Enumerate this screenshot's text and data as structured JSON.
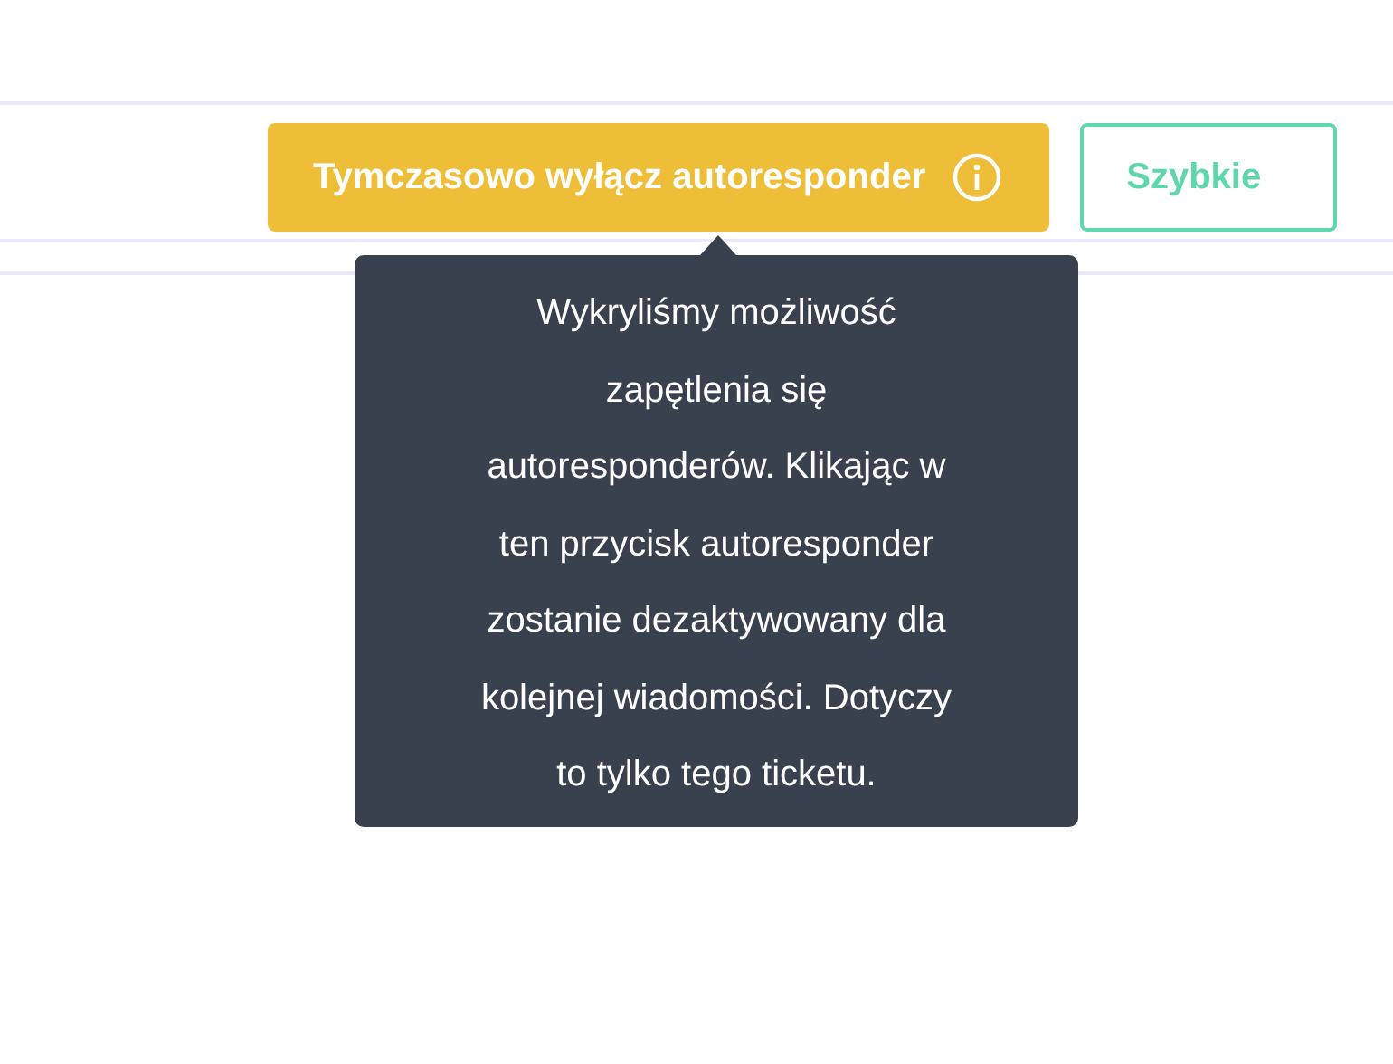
{
  "toolbar": {
    "buttons": [
      {
        "kind": "warning",
        "label": "Tymczasowo wyłącz autoresponder"
      },
      {
        "kind": "outline",
        "label": "Szybkie"
      }
    ]
  },
  "tooltip": {
    "lines": [
      "Wykryliśmy możliwość",
      "zapętlenia się",
      "autoresponderów. Klikając w",
      "ten przycisk autoresponder",
      "zostanie dezaktywowany dla",
      "kolejnej wiadomości. Dotyczy",
      "to tylko tego ticketu."
    ]
  }
}
